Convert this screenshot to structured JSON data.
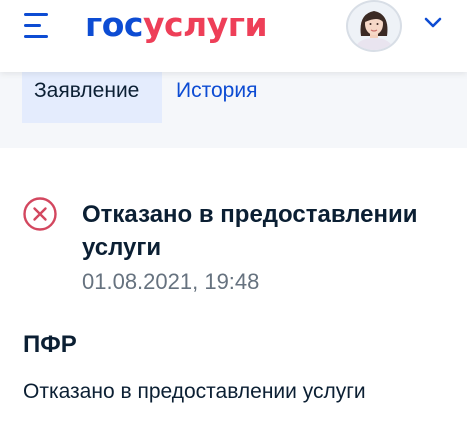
{
  "header": {
    "logo_part1": "гос",
    "logo_part2": "услуги",
    "colors": {
      "brand_blue": "#0d4cd3",
      "brand_red": "#ee3f58"
    },
    "menu_icon": "burger-menu-icon",
    "profile_icon": "user-avatar",
    "dropdown_icon": "chevron-down-icon"
  },
  "tabs": [
    {
      "label": "Заявление",
      "active": true
    },
    {
      "label": "История",
      "active": false
    }
  ],
  "status": {
    "icon": "error-circle-icon",
    "title": "Отказано в предоставлении услуги",
    "date": "01.08.2021, 19:48",
    "color": "#d3475f"
  },
  "organization": {
    "name": "ПФР",
    "description": "Отказано в предоставлении услуги"
  }
}
